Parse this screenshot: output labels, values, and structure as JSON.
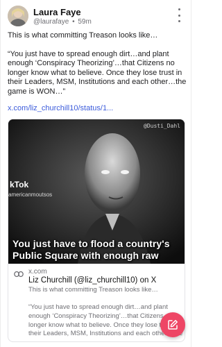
{
  "post": {
    "author": {
      "name": "Laura Faye",
      "handle": "@laurafaye",
      "separator": "•",
      "age": "59m"
    },
    "more_icon": "more-vertical-icon",
    "body": {
      "line_1": "This is what committing Treason looks like…",
      "quote": "“You just have to spread enough dirt…and plant enough ‘Conspiracy Theorizing’…that Citizens no longer know what to believe. Once they lose trust in their Leaders, MSM, Institutions and each other…the game is WON…”"
    },
    "link_text": "x.com/liz_churchill10/status/1..."
  },
  "embed": {
    "video": {
      "watermark": "@Dusti_Dahl",
      "tiktok_mark": "kTok",
      "tiktok_handle": "americanmoutsos",
      "caption": "You just have to flood a country's Public Square with enough raw"
    },
    "link_icon": "link-icon",
    "domain": "x.com",
    "title": "Liz Churchill (@liz_churchill10) on X",
    "desc_line": "This is what committing Treason looks like…",
    "desc_quote": "“You just have to spread enough dirt…and plant enough ‘Conspiracy Theorizing’…that Citizens no longer know what to believe. Once they lose trust in their Leaders, MSM, Institutions and each other…the game is WON…”"
  },
  "fab": {
    "icon": "compose-icon",
    "color": "#ee4665"
  },
  "colors": {
    "link": "#3b5bdb",
    "muted": "#6f6f74",
    "text": "#1d1d1f"
  }
}
